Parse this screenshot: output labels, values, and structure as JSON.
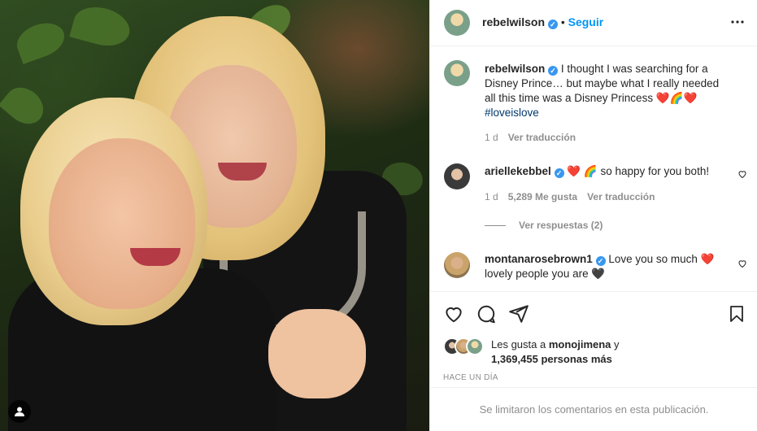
{
  "post": {
    "author": "rebelwilson",
    "follow_label": "Seguir",
    "caption": {
      "author": "rebelwilson",
      "text": "I thought I was searching for a Disney Prince… but maybe what I really needed all this time was a Disney Princess",
      "emojis": "❤️🌈❤️",
      "hashtag": "#loveislove",
      "age": "1 d",
      "translate_label": "Ver traducción"
    }
  },
  "comments": [
    {
      "author": "ariellekebbel",
      "emojis_before": "❤️ 🌈",
      "text": "so happy for you both!",
      "age": "1 d",
      "likes": "5,289 Me gusta",
      "translate_label": "Ver traducción",
      "replies_label": "Ver respuestas (2)"
    },
    {
      "author": "montanarosebrown1",
      "text": "Love you so much",
      "emoji_after": "❤️",
      "text2": "lovely people you are",
      "emoji_end": "🖤"
    }
  ],
  "likes": {
    "prefix": "Les gusta a",
    "first_user": "monojimena",
    "connector": "y",
    "others": "1,369,455 personas más"
  },
  "timestamp": "HACE UN DÍA",
  "footer_notice": "Se limitaron los comentarios en esta publicación.",
  "icons": {
    "verified": "verified-badge-icon",
    "more": "more-options-icon",
    "like": "heart-icon",
    "comment": "comment-icon",
    "share": "share-icon",
    "save": "bookmark-icon",
    "tag": "user-tag-icon"
  },
  "colors": {
    "accent": "#0095f6",
    "verified": "#3897f0",
    "heart": "#ed4956"
  }
}
